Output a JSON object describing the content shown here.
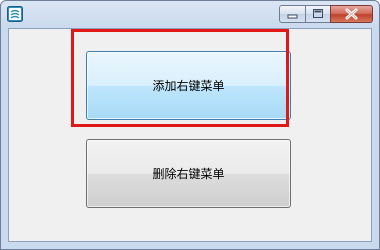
{
  "window": {
    "title": "",
    "icon": "app-icon"
  },
  "caption_buttons": {
    "minimize_icon": "minimize-icon",
    "maximize_icon": "maximize-icon",
    "close_icon": "close-icon"
  },
  "buttons": {
    "add_label": "添加右键菜单",
    "delete_label": "删除右键菜单"
  },
  "colors": {
    "highlight": "#e01818"
  }
}
